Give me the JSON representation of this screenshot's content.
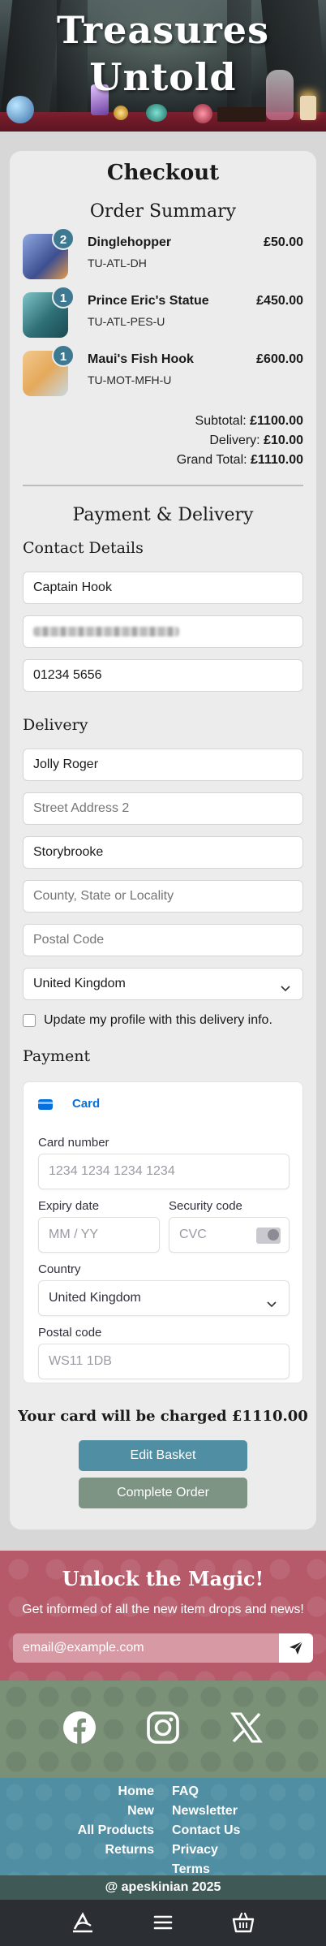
{
  "brand": {
    "title_line1": "Treasures",
    "title_line2": "Untold"
  },
  "checkout": {
    "title": "Checkout",
    "order_summary_title": "Order Summary",
    "items": [
      {
        "qty": "2",
        "name": "Dinglehopper",
        "sku": "TU-ATL-DH",
        "price": "£50.00",
        "thumb_color": "#5a6fb0"
      },
      {
        "qty": "1",
        "name": "Prince Eric's Statue",
        "sku": "TU-ATL-PES-U",
        "price": "£450.00",
        "thumb_color": "#3f8a8f"
      },
      {
        "qty": "1",
        "name": "Maui's Fish Hook",
        "sku": "TU-MOT-MFH-U",
        "price": "£600.00",
        "thumb_color": "#e5a95b"
      }
    ],
    "totals": {
      "subtotal_label": "Subtotal:",
      "subtotal": "£1100.00",
      "delivery_label": "Delivery:",
      "delivery": "£10.00",
      "grand_total_label": "Grand Total:",
      "grand_total": "£1110.00"
    },
    "payment_delivery_title": "Payment & Delivery",
    "contact_title": "Contact Details",
    "contact": {
      "name": "Captain Hook",
      "phone": "01234 5656"
    },
    "delivery_title": "Delivery",
    "delivery": {
      "address1": "Jolly Roger",
      "address2_placeholder": "Street Address 2",
      "town": "Storybrooke",
      "county_placeholder": "County, State or Locality",
      "postcode_placeholder": "Postal Code",
      "country": "United Kingdom",
      "save_profile_label": "Update my profile with this delivery info."
    },
    "payment_title": "Payment",
    "payment": {
      "tab_label": "Card",
      "card_number_label": "Card number",
      "card_number_placeholder": "1234 1234 1234 1234",
      "expiry_label": "Expiry date",
      "expiry_placeholder": "MM / YY",
      "cvc_label": "Security code",
      "cvc_placeholder": "CVC",
      "country_label": "Country",
      "country": "United Kingdom",
      "postal_label": "Postal code",
      "postal_placeholder": "WS11 1DB"
    },
    "charge_text": "Your card will be charged £1110.00",
    "edit_basket_label": "Edit Basket",
    "complete_order_label": "Complete Order"
  },
  "newsletter": {
    "title": "Unlock the Magic!",
    "subtitle": "Get informed of all the new item drops and news!",
    "email_placeholder": "email@example.com"
  },
  "social": {
    "icons": [
      "facebook-icon",
      "instagram-icon",
      "x-icon"
    ]
  },
  "footer": {
    "left_links": [
      "Home",
      "New",
      "All Products",
      "Returns"
    ],
    "right_links": [
      "FAQ",
      "Newsletter",
      "Contact Us",
      "Privacy",
      "Terms"
    ],
    "copyright": "@ apeskinian 2025"
  },
  "bottom_nav": {
    "icons": [
      "logo-icon",
      "menu-icon",
      "basket-icon"
    ]
  },
  "colors": {
    "accent_blue": "#4f8ea3",
    "accent_green": "#7d9383",
    "newsletter_bg": "#b65a6a",
    "social_bg": "#7a9077",
    "badge": "#3d7a92"
  }
}
